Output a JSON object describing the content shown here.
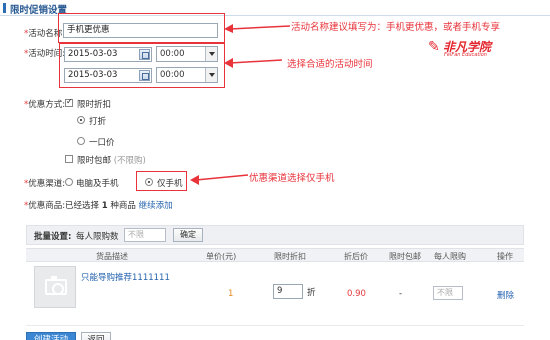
{
  "page": {
    "title": "限时促销设置"
  },
  "form": {
    "activity_name_label": "活动名称:",
    "activity_name_value": "手机更优惠",
    "activity_time_label": "活动时间:",
    "start_date": "2015-03-03",
    "start_time": "00:00",
    "end_date": "2015-03-03",
    "end_time": "00:00",
    "discount_method_label": "优惠方式:",
    "limited_discount_label": "限时折扣",
    "option_discount": "打折",
    "option_fixed_price": "一口价",
    "free_shipping_label": "限时包邮",
    "free_shipping_note": "(不限购)",
    "channel_label": "优惠渠道:",
    "channel_pc_mobile": "电脑及手机",
    "channel_mobile_only": "仅手机",
    "products_label": "优惠商品:",
    "products_selected_text": "已经选择",
    "products_count": "1",
    "products_unit": "种商品",
    "continue_add_link": "继续添加"
  },
  "annotations": {
    "name_tip": "活动名称建议填写为：手机更优惠，或者手机专享",
    "time_tip": "选择合适的活动时间",
    "channel_tip": "优惠渠道选择仅手机"
  },
  "logo": {
    "text": "非凡学院",
    "sub": "FeiFan Education"
  },
  "batch": {
    "label": "批量设置:",
    "per_person_label": "每人限购数",
    "input_placeholder": "不限",
    "confirm_button": "确定"
  },
  "table": {
    "headers": [
      "货品描述",
      "单价(元)",
      "限时折扣",
      "折后价",
      "限时包邮",
      "每人限购",
      "操作"
    ],
    "rows": [
      {
        "name": "只能导购推荐1111111",
        "unit_price": "1",
        "discount": "9",
        "discount_unit": "折",
        "final_price": "0.90",
        "free_shipping": "-",
        "limit_placeholder": "不限",
        "action": "删除"
      }
    ]
  },
  "buttons": {
    "create": "创建活动",
    "back": "返回"
  },
  "colors": {
    "annotation_red": "#e8333a",
    "link_blue": "#2563b0",
    "primary_button": "#3b87d3"
  }
}
